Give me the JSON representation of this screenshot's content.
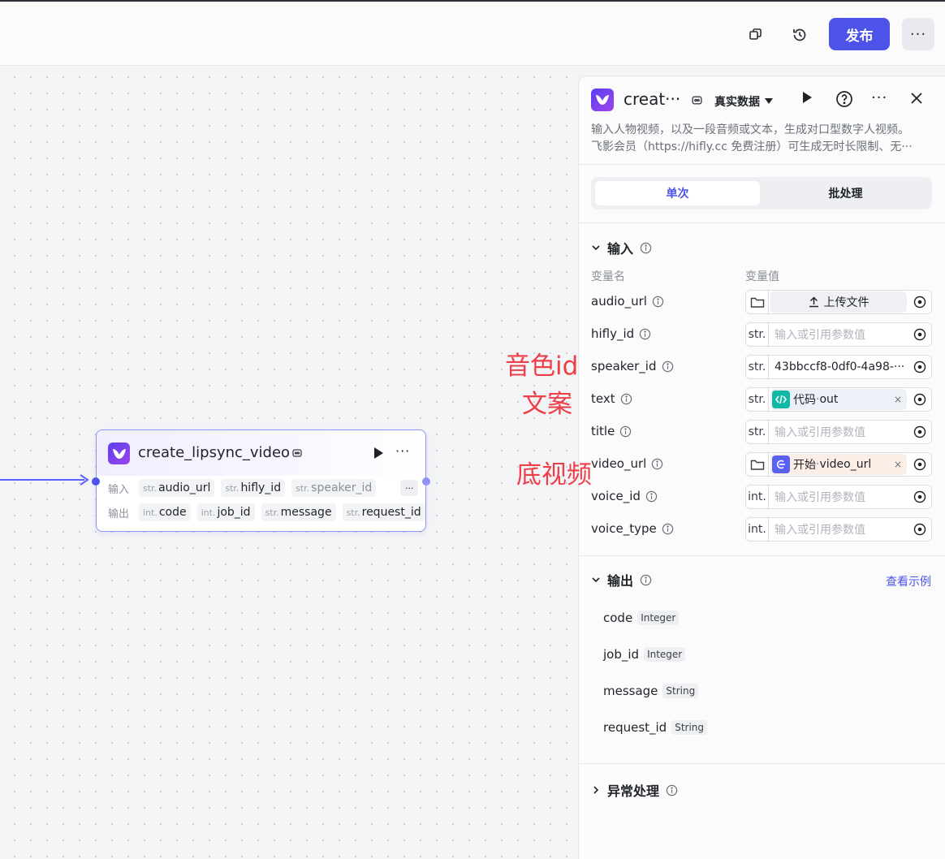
{
  "topbar": {
    "publish_label": "发布",
    "more_label": "···",
    "icons": [
      "copy-icon",
      "history-icon"
    ]
  },
  "node": {
    "title": "create_lipsync_video",
    "input_label": "输入",
    "output_label": "输出",
    "inputs": [
      {
        "type": "str.",
        "name": "audio_url"
      },
      {
        "type": "str.",
        "name": "hifly_id"
      },
      {
        "type": "str.",
        "name": "speaker_id"
      }
    ],
    "outputs": [
      {
        "type": "int.",
        "name": "code"
      },
      {
        "type": "int.",
        "name": "job_id"
      },
      {
        "type": "str.",
        "name": "message"
      },
      {
        "type": "str.",
        "name": "request_id"
      }
    ],
    "more": "···"
  },
  "annotations": {
    "speaker": "音色id",
    "text": "文案",
    "video": "底视频"
  },
  "panel": {
    "title": "creat···",
    "data_mode": "真实数据",
    "description_line1": "输入人物视频，以及一段音频或文本，生成对口型数字人视频。",
    "description_line2": "飞影会员（https://hifly.cc 免费注册）可生成无时长限制、无···",
    "tab_single": "单次",
    "tab_batch": "批处理",
    "input_section": "输入",
    "col_name": "变量名",
    "col_value": "变量值",
    "params": [
      {
        "name": "audio_url",
        "kind": "upload",
        "value": "上传文件"
      },
      {
        "name": "hifly_id",
        "kind": "text",
        "type": "str.",
        "placeholder": "输入或引用参数值"
      },
      {
        "name": "speaker_id",
        "kind": "filled",
        "type": "str.",
        "value": "43bbccf8-0df0-4a98-···"
      },
      {
        "name": "text",
        "kind": "ref",
        "type": "str.",
        "ref_node": "代码",
        "ref_sep": " · ",
        "ref_var": "out"
      },
      {
        "name": "title",
        "kind": "text",
        "type": "str.",
        "placeholder": "输入或引用参数值"
      },
      {
        "name": "video_url",
        "kind": "ref-file",
        "ref_node": "开始",
        "ref_sep": " · ",
        "ref_var": "video_url"
      },
      {
        "name": "voice_id",
        "kind": "text",
        "type": "int.",
        "placeholder": "输入或引用参数值"
      },
      {
        "name": "voice_type",
        "kind": "text",
        "type": "int.",
        "placeholder": "输入或引用参数值"
      }
    ],
    "output_section": "输出",
    "view_example": "查看示例",
    "outputs": [
      {
        "name": "code",
        "type": "Integer"
      },
      {
        "name": "job_id",
        "type": "Integer"
      },
      {
        "name": "message",
        "type": "String"
      },
      {
        "name": "request_id",
        "type": "String"
      }
    ],
    "error_section": "异常处理",
    "chip_close": "×"
  },
  "colors": {
    "accent": "#4d53e8",
    "annotation": "#ee3f49"
  }
}
